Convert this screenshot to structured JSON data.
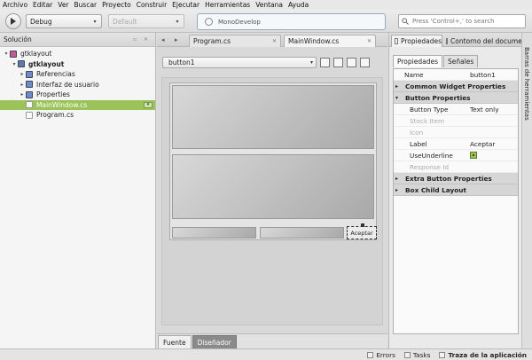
{
  "menu": [
    "Archivo",
    "Editar",
    "Ver",
    "Buscar",
    "Proyecto",
    "Construir",
    "Ejecutar",
    "Herramientas",
    "Ventana",
    "Ayuda"
  ],
  "toolbar": {
    "config": "Debug",
    "target": "Default",
    "status": "MonoDevelop",
    "search_placeholder": "Press 'Control+,' to search"
  },
  "solution": {
    "title": "Solución",
    "items": [
      {
        "label": "gtklayout",
        "level": 0,
        "bold": false,
        "expander": "▾",
        "icon": "solution-icon"
      },
      {
        "label": "gtklayout",
        "level": 1,
        "bold": true,
        "expander": "▾",
        "icon": "project-icon"
      },
      {
        "label": "Referencias",
        "level": 2,
        "bold": false,
        "expander": "▸",
        "icon": "folder-icon"
      },
      {
        "label": "Interfaz de usuario",
        "level": 2,
        "bold": false,
        "expander": "▸",
        "icon": "folder-icon"
      },
      {
        "label": "Properties",
        "level": 2,
        "bold": false,
        "expander": "▸",
        "icon": "folder-icon"
      },
      {
        "label": "MainWindow.cs",
        "level": 2,
        "bold": false,
        "expander": "",
        "icon": "file-icon",
        "selected": true
      },
      {
        "label": "Program.cs",
        "level": 2,
        "bold": false,
        "expander": "",
        "icon": "file-icon"
      }
    ]
  },
  "editor": {
    "tabs": [
      {
        "label": "Program.cs",
        "active": false
      },
      {
        "label": "MainWindow.cs",
        "active": true
      }
    ],
    "widget_selector": "button1",
    "accept_button_label": "Aceptar",
    "bottom_tabs": [
      {
        "label": "Fuente",
        "active": false
      },
      {
        "label": "Diseñador",
        "active": true
      }
    ]
  },
  "properties_pane": {
    "tabs": [
      "Propiedades",
      "Contorno del documento"
    ],
    "subtabs": [
      "Propiedades",
      "Señales"
    ],
    "rows": [
      {
        "type": "prop",
        "name": "Name",
        "value": "button1"
      },
      {
        "type": "group",
        "name": "Common Widget Properties",
        "expander": "▸"
      },
      {
        "type": "group",
        "name": "Button Properties",
        "expander": "▾"
      },
      {
        "type": "prop",
        "name": "Button Type",
        "value": "Text only"
      },
      {
        "type": "prop",
        "name": "Stock Item",
        "value": "",
        "muted": true
      },
      {
        "type": "prop",
        "name": "Icon",
        "value": "",
        "muted": true
      },
      {
        "type": "prop",
        "name": "Label",
        "value": "Aceptar"
      },
      {
        "type": "check",
        "name": "UseUnderline",
        "value": ""
      },
      {
        "type": "prop",
        "name": "Response Id",
        "value": "",
        "muted": true
      },
      {
        "type": "group",
        "name": "Extra Button Properties",
        "expander": "▸"
      },
      {
        "type": "group",
        "name": "Box Child Layout",
        "expander": "▸"
      }
    ]
  },
  "tool_strip_label": "Barras de herramientas",
  "statusbar": {
    "errors": "Errors",
    "tasks": "Tasks",
    "trace": "Traza de la aplicación"
  }
}
